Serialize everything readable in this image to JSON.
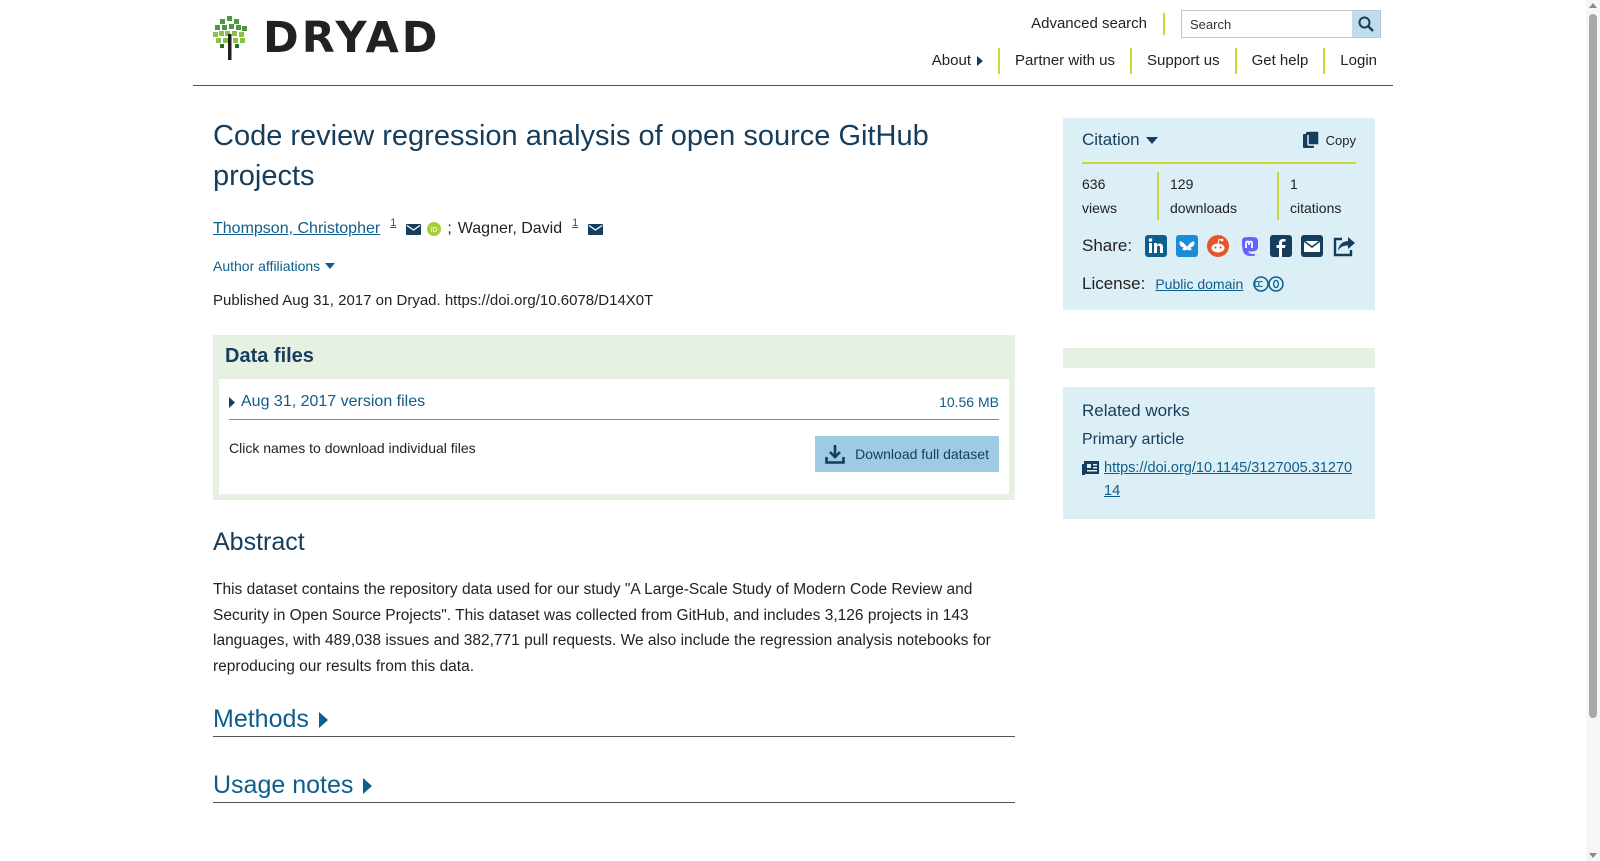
{
  "header": {
    "logo_text": "DRYAD",
    "advanced_search": "Advanced search",
    "search_placeholder": "Search",
    "nav": [
      "About",
      "Partner with us",
      "Support us",
      "Get help",
      "Login"
    ]
  },
  "dataset": {
    "title": "Code review regression analysis of open source GitHub projects",
    "authors": [
      {
        "name": "Thompson, Christopher",
        "affil": "1"
      },
      {
        "name": "Wagner, David",
        "affil": "1"
      }
    ],
    "author_separator": ";",
    "affiliations_toggle": "Author affiliations",
    "published": "Published Aug 31, 2017 on Dryad. https://doi.org/10.6078/D14X0T"
  },
  "data_files": {
    "heading": "Data files",
    "version_title": "Aug 31, 2017 version files",
    "version_size": "10.56 MB",
    "hint": "Click names to download individual files",
    "download_label": "Download full dataset"
  },
  "abstract": {
    "heading": "Abstract",
    "text": "This dataset contains the repository data used for our study \"A Large-Scale Study of Modern Code Review and Security in Open Source Projects\". This dataset was collected from GitHub, and includes 3,126 projects in 143 languages, with 489,038 issues and 382,771 pull requests. We also include the regression analysis notebooks for reproducing our results from this data."
  },
  "sections": {
    "methods": "Methods",
    "usage_notes": "Usage notes"
  },
  "citation": {
    "heading": "Citation",
    "copy": "Copy",
    "metrics": [
      {
        "value": "636",
        "label": "views"
      },
      {
        "value": "129",
        "label": "downloads"
      },
      {
        "value": "1",
        "label": "citations"
      }
    ],
    "share_label": "Share:",
    "share_icons": [
      "linkedin-icon",
      "bluesky-icon",
      "reddit-icon",
      "mastodon-icon",
      "facebook-icon",
      "email-icon",
      "share-icon"
    ],
    "license_label": "License:",
    "license_value": "Public domain"
  },
  "related": {
    "heading": "Related works",
    "subheading": "Primary article",
    "link": "https://doi.org/10.1145/3127005.3127014"
  },
  "colors": {
    "navy": "#163d5c",
    "link": "#0d5e8c",
    "accent_green": "#c8d83a",
    "panel_blue": "#dceef6",
    "panel_green": "#e6f1e4",
    "button_blue": "#9ecbe3"
  }
}
